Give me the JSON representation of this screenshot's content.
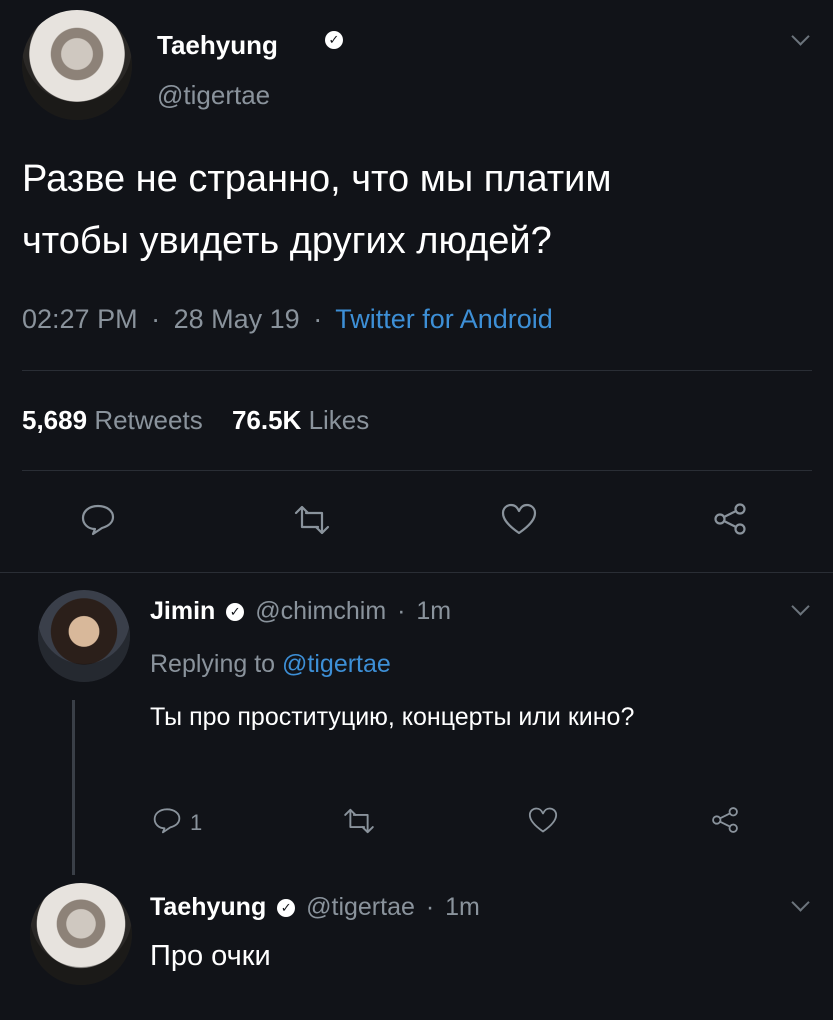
{
  "main_tweet": {
    "display_name": "Taehyung",
    "handle": "@tigertae",
    "text_line1": "Разве не странно, что мы платим",
    "text_line2": "чтобы увидеть других людей?",
    "time": "02:27 PM",
    "date": "28 May 19",
    "separator": "·",
    "client": "Twitter for Android",
    "retweets_count": "5,689",
    "retweets_label": "Retweets",
    "likes_count": "76.5K",
    "likes_label": "Likes"
  },
  "reply_1": {
    "display_name": "Jimin",
    "handle": "@chimchim",
    "separator": "·",
    "time": "1m",
    "replying_prefix": "Replying to",
    "replying_handle": "@tigertae",
    "text": "Ты про проституцию, концерты или кино?",
    "reply_count": "1"
  },
  "reply_2": {
    "display_name": "Taehyung",
    "handle": "@tigertae",
    "separator": "·",
    "time": "1m",
    "text": "Про очки"
  },
  "icons": {
    "verified": "verified-badge-icon",
    "reply": "comment-icon",
    "retweet": "retweet-icon",
    "like": "heart-icon",
    "share": "share-icon",
    "menu": "chevron-down-icon"
  },
  "colors": {
    "background": "#111318",
    "text": "#e9ecef",
    "muted": "#8a939c",
    "link": "#3d8fd6"
  }
}
